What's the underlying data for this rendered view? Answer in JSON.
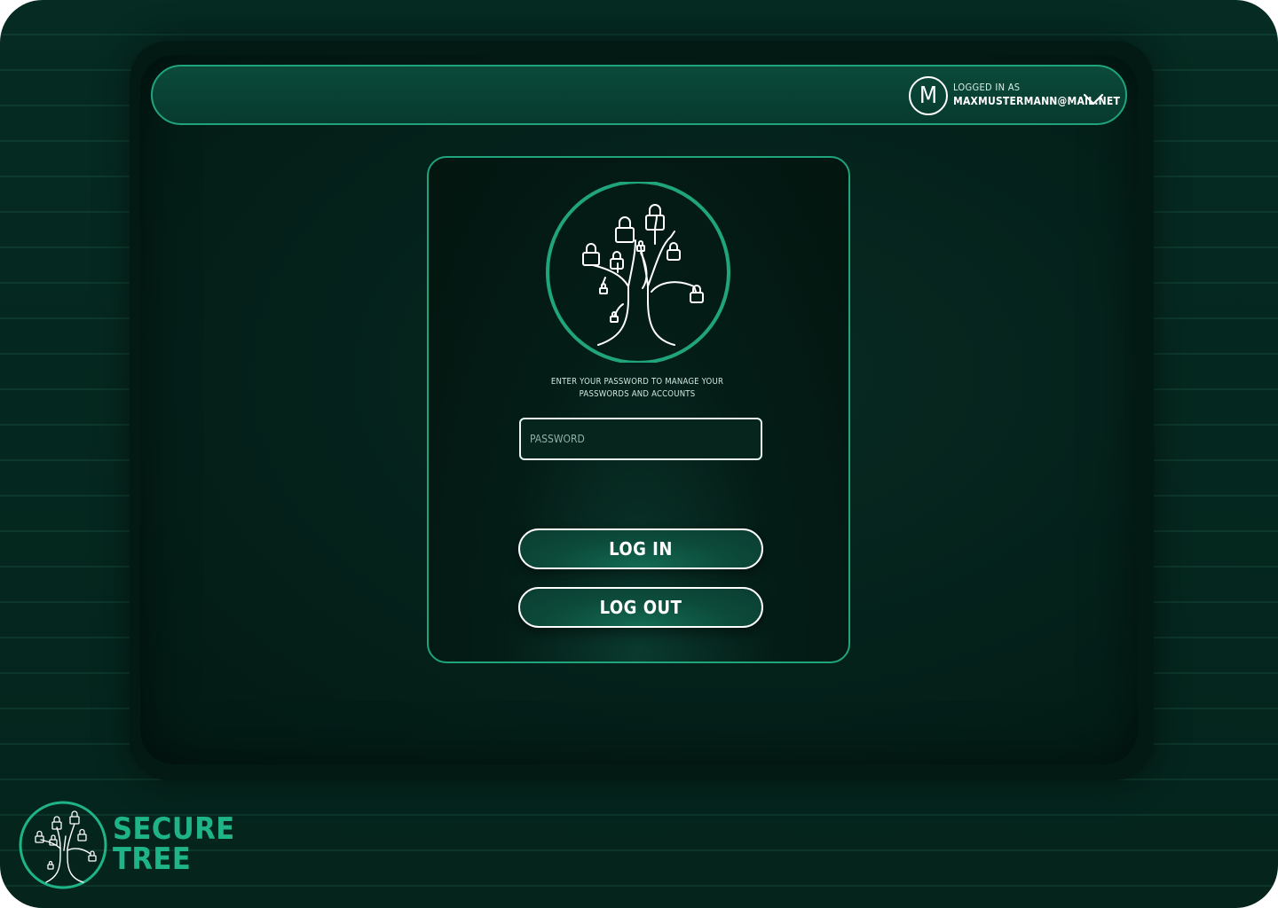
{
  "header": {
    "avatar_initial": "M",
    "logged_in_caption": "LOGGED IN AS",
    "user_email": "MAXMUSTERMANN@MAIL.NET"
  },
  "login_card": {
    "instruction_line1": "ENTER YOUR PASSWORD TO MANAGE YOUR",
    "instruction_line2": "PASSWORDS AND ACCOUNTS",
    "password_placeholder": "PASSWORD",
    "password_value": "",
    "login_button_label": "LOG IN",
    "logout_button_label": "LOG OUT"
  },
  "brand": {
    "line1": "SECURE",
    "line2": "TREE"
  },
  "icons": {
    "avatar": "user-initial-avatar",
    "dropdown": "chevron-down-icon",
    "emblem": "lock-tree-icon",
    "brand_logo": "lock-tree-logo-icon"
  },
  "colors": {
    "accent": "#1fa47c",
    "brand_text": "#1fb488",
    "background": "#04241c",
    "text": "#ffffff"
  }
}
